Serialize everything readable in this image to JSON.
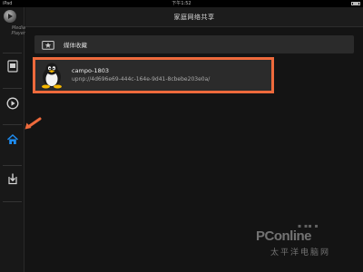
{
  "statusbar": {
    "carrier": "iPad",
    "time": "下午1:52"
  },
  "sidebar": {
    "logo_text_line1": "Media",
    "logo_text_line2": "Player",
    "items": [
      {
        "icon": "document-icon"
      },
      {
        "icon": "play-circle-icon"
      },
      {
        "icon": "home-network-icon",
        "active": true
      },
      {
        "icon": "download-icon"
      }
    ],
    "active_color": "#1e8cf0"
  },
  "header": {
    "title": "家庭网络共享"
  },
  "main": {
    "favorites_label": "媒体收藏",
    "device": {
      "name": "campo-1803",
      "udn": "upnp://4d696e69-444c-164e-9d41-8cbebe203e0a/"
    },
    "highlight_color": "#ee6a3c"
  },
  "watermark": {
    "brand": "PConline",
    "sub": "太平洋电脑网"
  }
}
